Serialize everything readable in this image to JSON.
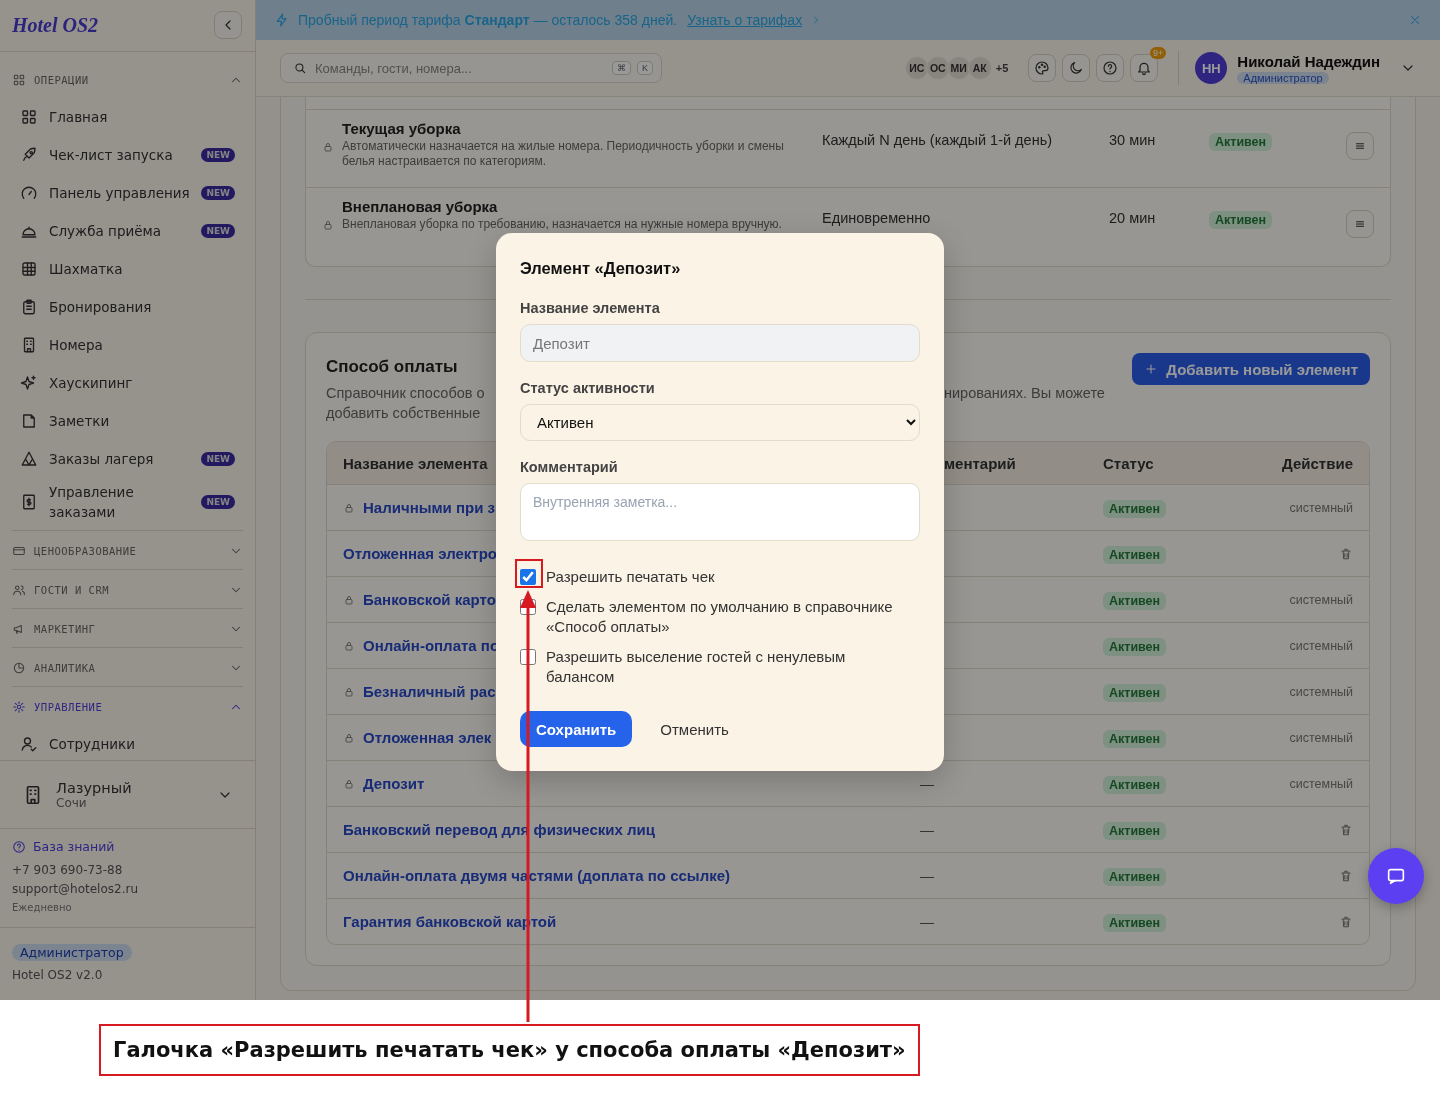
{
  "banner": {
    "text": "Пробный период тарифа **Стандарт** — осталось 358 дней.",
    "link": "Узнать о тарифах"
  },
  "sidebar": {
    "logo": "Hotel OS2",
    "sections": [
      {
        "title": "ОПЕРАЦИИ",
        "expanded": true,
        "selected": false,
        "items": [
          {
            "label": "Главная"
          },
          {
            "label": "Чек-лист запуска",
            "badge": "NEW"
          },
          {
            "label": "Панель управления",
            "badge": "NEW"
          },
          {
            "label": "Служба приёма",
            "badge": "NEW"
          },
          {
            "label": "Шахматка"
          },
          {
            "label": "Бронирования"
          },
          {
            "label": "Номера"
          },
          {
            "label": "Хаускипинг"
          },
          {
            "label": "Заметки"
          },
          {
            "label": "Заказы лагеря",
            "badge": "NEW"
          },
          {
            "label": "Управление заказами",
            "badge": "NEW"
          }
        ]
      },
      {
        "title": "ЦЕНООБРАЗОВАНИЕ",
        "expanded": false,
        "selected": false
      },
      {
        "title": "ГОСТИ И CRM",
        "expanded": false,
        "selected": false
      },
      {
        "title": "МАРКЕТИНГ",
        "expanded": false,
        "selected": false
      },
      {
        "title": "АНАЛИТИКА",
        "expanded": false,
        "selected": false
      },
      {
        "title": "УПРАВЛЕНИЕ",
        "expanded": true,
        "selected": true,
        "items": [
          {
            "label": "Сотрудники"
          }
        ]
      }
    ],
    "property": {
      "name": "Лазурный",
      "city": "Сочи"
    },
    "help": {
      "link": "База знаний",
      "phone": "+7 903 690-73-88",
      "email": "support@hotelos2.ru",
      "hours": "Ежедневно"
    },
    "role": "Администратор",
    "version": "Hotel OS2 v2.0"
  },
  "toolbar": {
    "search": {
      "placeholder": "Команды, гости, номера...",
      "keys": [
        "⌘",
        "K"
      ]
    },
    "avatars": [
      "ИС",
      "ОС",
      "МИ",
      "АК"
    ],
    "more": "+5",
    "notifications": "9+",
    "user": {
      "initials": "НН",
      "name": "Николай Надеждин",
      "role": "Администратор"
    }
  },
  "housekeeping": {
    "rows": [
      {
        "title": "Текущая уборка",
        "description": "Автоматически назначается на жилые номера. Периодичность уборки и смены белья настраивается по категориям.",
        "locked": true,
        "schedule": "Каждый N день (каждый 1-й день)",
        "duration": "30 мин",
        "status": "Активен"
      },
      {
        "title": "Внеплановая уборка",
        "description": "Внеплановая уборка по требованию, назначается на нужные номера вручную.",
        "locked": true,
        "schedule": "Единовременно",
        "duration": "20 мин",
        "status": "Активен"
      }
    ]
  },
  "payment_methods": {
    "title": "Способ оплаты",
    "description_left": [
      "Справочник способов о",
      "добавить собственные"
    ],
    "description_right": "нированиях. Вы можете",
    "add_button": "Добавить новый элемент",
    "columns": [
      "Название элемента",
      "ментарий",
      "Статус",
      "Действие"
    ],
    "rows": [
      {
        "name": "Наличными при з",
        "locked": true,
        "status": "Активен",
        "action": {
          "kind": "label",
          "text": "системный"
        }
      },
      {
        "name": "Отложенная электро",
        "locked": false,
        "status": "Активен",
        "action": {
          "kind": "delete"
        }
      },
      {
        "name": "Банковской карто",
        "locked": true,
        "status": "Активен",
        "action": {
          "kind": "label",
          "text": "системный"
        }
      },
      {
        "name": "Онлайн-оплата по",
        "locked": true,
        "status": "Активен",
        "action": {
          "kind": "label",
          "text": "системный"
        }
      },
      {
        "name": "Безналичный рас",
        "locked": true,
        "status": "Активен",
        "action": {
          "kind": "label",
          "text": "системный"
        }
      },
      {
        "name": "Отложенная элек",
        "locked": true,
        "status": "Активен",
        "action": {
          "kind": "label",
          "text": "системный"
        }
      },
      {
        "name": "Депозит",
        "locked": true,
        "comment": "—",
        "status": "Активен",
        "action": {
          "kind": "label",
          "text": "системный"
        }
      },
      {
        "name": "Банковский перевод для физических лиц",
        "locked": false,
        "comment": "—",
        "status": "Активен",
        "action": {
          "kind": "delete"
        }
      },
      {
        "name": "Онлайн-оплата двумя частями (доплата по ссылке)",
        "locked": false,
        "comment": "—",
        "status": "Активен",
        "action": {
          "kind": "delete"
        }
      },
      {
        "name": "Гарантия банковской картой",
        "locked": false,
        "comment": "—",
        "status": "Активен",
        "action": {
          "kind": "delete"
        }
      }
    ]
  },
  "modal": {
    "title": "Элемент «Депозит»",
    "fields": [
      {
        "kind": "text",
        "label": "Название элемента",
        "value": "Депозит",
        "disabled": true
      },
      {
        "kind": "select",
        "label": "Статус активности",
        "value": "Активен"
      },
      {
        "kind": "textarea",
        "label": "Комментарий",
        "placeholder": "Внутренняя заметка..."
      }
    ],
    "checkboxes": [
      {
        "label": "Разрешить печатать чек",
        "checked": true
      },
      {
        "label": "Сделать элементом по умолчанию в справочнике «Способ оплаты»",
        "checked": false
      },
      {
        "label": "Разрешить выселение гостей с ненулевым балансом",
        "checked": false
      }
    ],
    "save": "Сохранить",
    "cancel": "Отменить"
  },
  "annotation": {
    "caption": "Галочка «Разрешить печатать чек» у способа оплаты «Депозит»"
  }
}
